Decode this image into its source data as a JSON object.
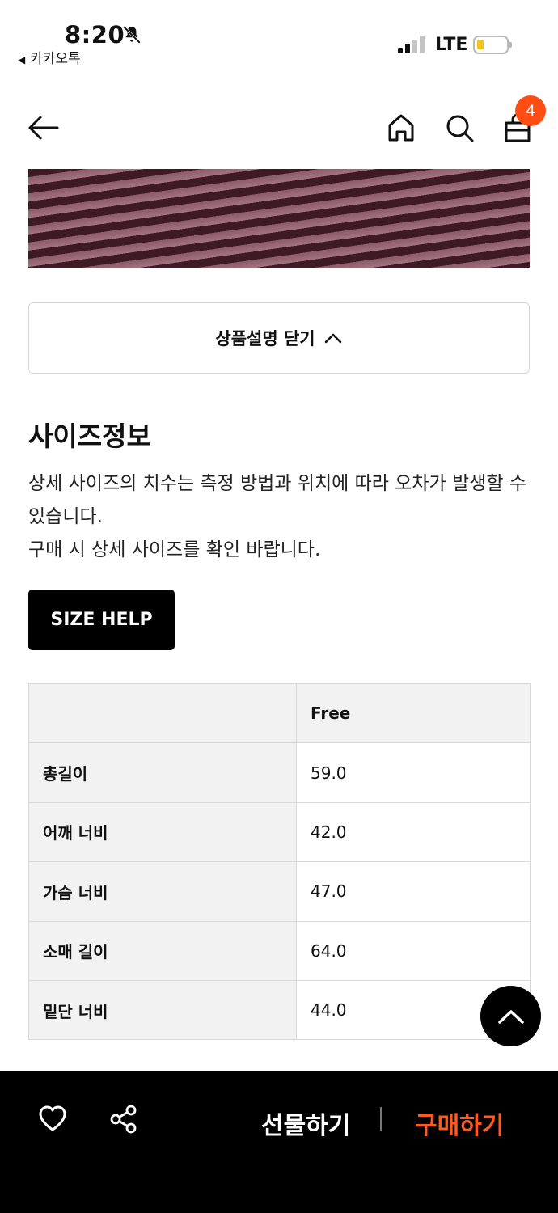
{
  "status_bar": {
    "time": "8:20",
    "back_app": "카카오톡",
    "network": "LTE",
    "icons": [
      "bell-slash-icon",
      "signal-icon",
      "battery-icon"
    ]
  },
  "nav": {
    "cart_count": "4",
    "icons": [
      "back-arrow-icon",
      "home-icon",
      "search-icon",
      "shopping-bag-icon"
    ]
  },
  "product_image": {
    "alt": "striped fabric",
    "colors": {
      "dark": "#3d1a24",
      "light": "#a27380"
    }
  },
  "description_toggle": {
    "label": "상품설명 닫기"
  },
  "size_info": {
    "title": "사이즈정보",
    "description_lines": [
      "상세 사이즈의 치수는 측정 방법과 위치에 따라 오차가 발생할 수 있습니다.",
      "구매 시 상세 사이즈를 확인 바랍니다."
    ],
    "size_help_label": "SIZE HELP",
    "table": {
      "header": [
        "",
        "Free"
      ],
      "rows": [
        {
          "label": "총길이",
          "value": "59.0"
        },
        {
          "label": "어깨 너비",
          "value": "42.0"
        },
        {
          "label": "가슴 너비",
          "value": "47.0"
        },
        {
          "label": "소매 길이",
          "value": "64.0"
        },
        {
          "label": "밑단 너비",
          "value": "44.0"
        }
      ]
    }
  },
  "bottom_bar": {
    "gift_label": "선물하기",
    "buy_label": "구매하기",
    "colors": {
      "background": "#000000",
      "buy": "#ff5a1f",
      "badge": "#ff4d14"
    }
  }
}
